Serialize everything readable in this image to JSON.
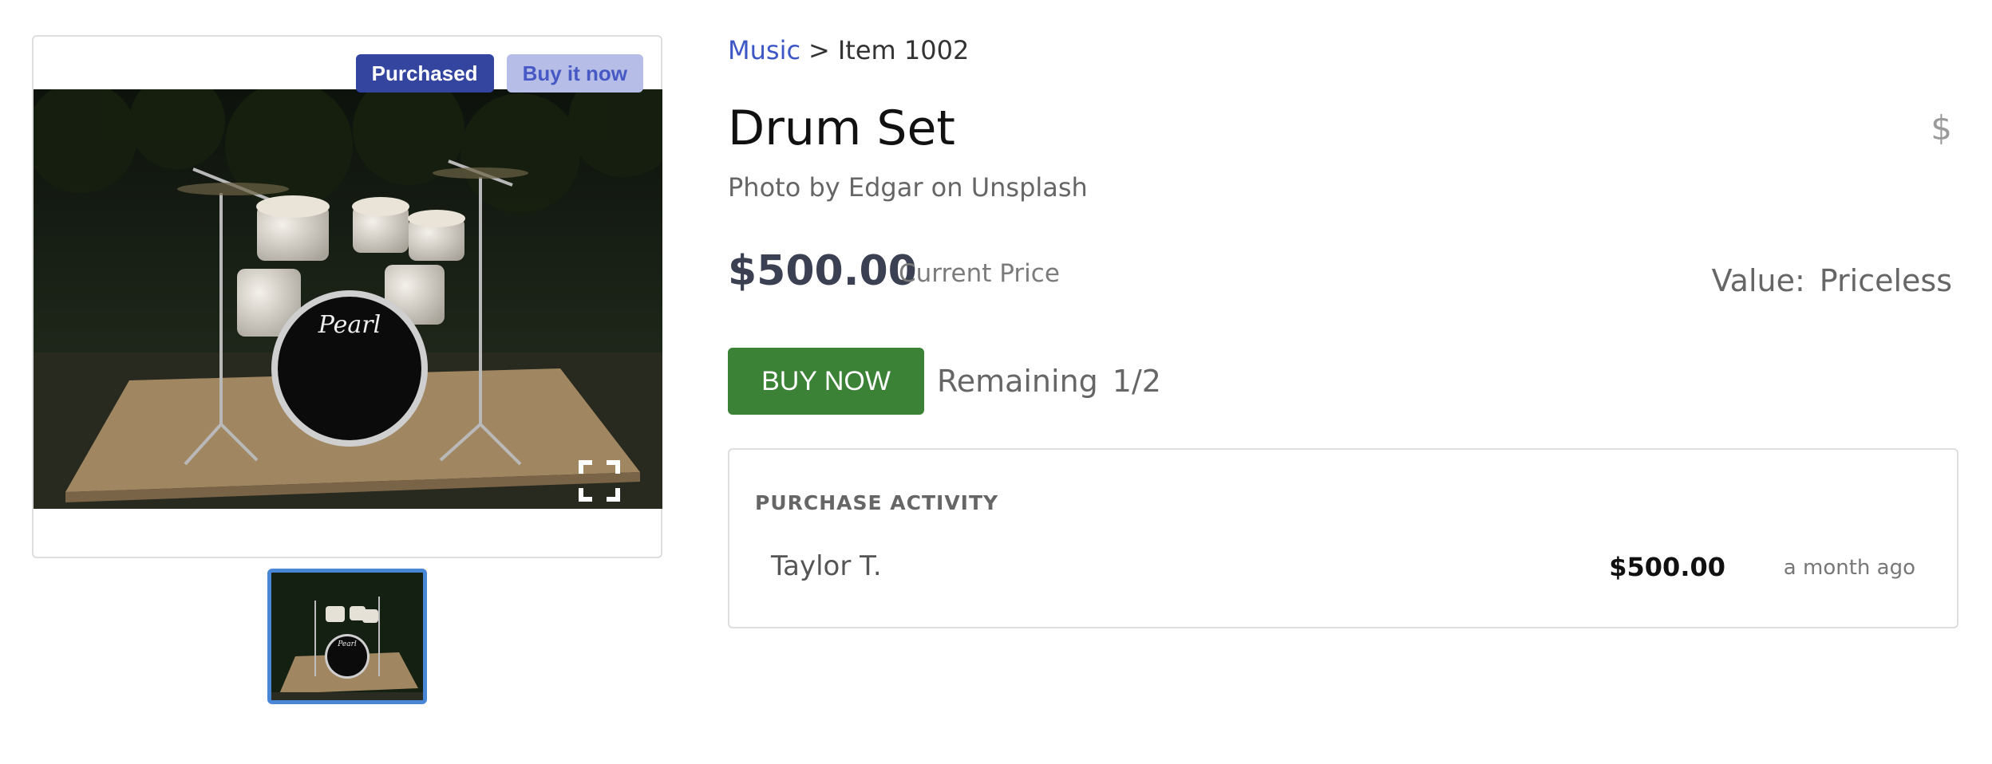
{
  "product": {
    "badges": {
      "purchased": "Purchased",
      "buy_it_now": "Buy it now"
    },
    "photo_alt": "Drum Set",
    "icons": {
      "expand": "expand-icon",
      "currency": "dollar-icon"
    }
  },
  "breadcrumb": {
    "category": "Music",
    "separator": ">",
    "item": "Item 1002"
  },
  "title": "Drum Set",
  "credit": "Photo by Edgar on Unsplash",
  "currency_symbol": "$",
  "price": {
    "amount": "$500.00",
    "label": "Current Price"
  },
  "value": {
    "label": "Value:",
    "text": "Priceless"
  },
  "buy": {
    "label": "BUY NOW",
    "remaining_label": "Remaining",
    "remaining_count": "1/2"
  },
  "activity": {
    "title": "PURCHASE ACTIVITY",
    "entries": [
      {
        "buyer": "Taylor T.",
        "amount": "$500.00",
        "time": "a month ago"
      }
    ]
  },
  "colors": {
    "badge_purchased": "#3445a0",
    "badge_buy": "#b6bde6",
    "link": "#3d57c7",
    "buy_button": "#3c8236",
    "thumb_border": "#4a86d6"
  }
}
